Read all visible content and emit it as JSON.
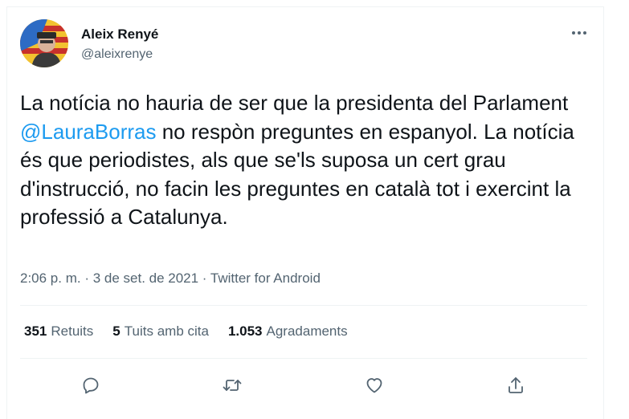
{
  "tweet": {
    "author_name": "Aleix Renyé",
    "author_handle": "@aleixrenye",
    "text_part1": "La notícia no hauria de ser que la presidenta del Parlament ",
    "mention": "@LauraBorras",
    "text_part2": " no respòn preguntes en espanyol. La notícia és que periodistes, als que se'ls suposa un cert grau d'instrucció, no facin les preguntes en català tot i exercint la professió a Catalunya.",
    "meta": "2:06 p. m. · 3 de set. de 2021 · Twitter for Android"
  },
  "stats": {
    "retweets_count": "351",
    "retweets_label": "Retuits",
    "quotes_count": "5",
    "quotes_label": "Tuits amb cita",
    "likes_count": "1.053",
    "likes_label": "Agradaments"
  },
  "icons": {
    "more": "more-options-icon",
    "reply": "reply-icon",
    "retweet": "retweet-icon",
    "like": "like-icon",
    "share": "share-icon"
  },
  "colors": {
    "link": "#1d9bf0",
    "secondary_text": "#536471",
    "primary_text": "#0f1419",
    "divider": "#eff3f4"
  }
}
